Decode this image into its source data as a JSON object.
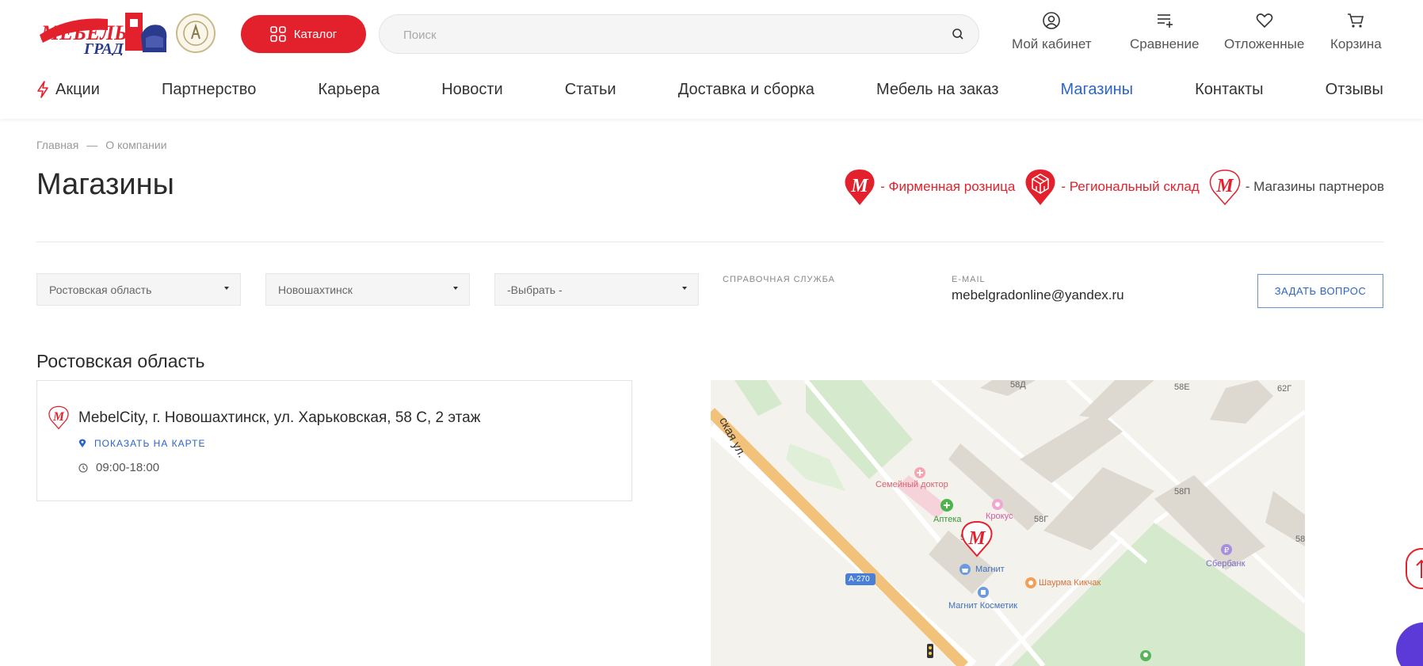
{
  "header": {
    "logo_text": "Мебель Град",
    "catalog_label": "Каталог",
    "search_placeholder": "Поиск",
    "actions": [
      {
        "label": "Мой кабинет",
        "icon": "user-icon"
      },
      {
        "label": "Сравнение",
        "icon": "compare-icon"
      },
      {
        "label": "Отложенные",
        "icon": "heart-icon"
      },
      {
        "label": "Корзина",
        "icon": "cart-icon"
      }
    ]
  },
  "nav": {
    "items": [
      "Акции",
      "Партнерство",
      "Карьера",
      "Новости",
      "Статьи",
      "Доставка и сборка",
      "Мебель на заказ",
      "Магазины",
      "Контакты",
      "Отзывы"
    ],
    "active": "Магазины"
  },
  "breadcrumb": {
    "home": "Главная",
    "separator": "—",
    "current": "О компании"
  },
  "page": {
    "title": "Магазины"
  },
  "legend": {
    "retail": "- Фирменная розница",
    "warehouse": "- Региональный склад",
    "partners": "- Магазины партнеров"
  },
  "filters": {
    "region": "Ростовская область",
    "city": "Новошахтинск",
    "store": "-Выбрать -"
  },
  "info": {
    "help_label": "СПРАВОЧНАЯ СЛУЖБА",
    "email_label": "E-MAIL",
    "email": "mebelgradonline@yandex.ru",
    "ask_button": "ЗАДАТЬ ВОПРОС"
  },
  "region": {
    "title": "Ростовская область",
    "store": {
      "name": "MebelCity, г. Новошахтинск, ул. Харьковская, 58 С, 2 этаж",
      "map_link": "ПОКАЗАТЬ НА КАРТЕ",
      "hours": "09:00-18:00"
    }
  },
  "map": {
    "street": "ская ул.",
    "road_badge": "А-270",
    "pois": {
      "doctor": "Семейный доктор",
      "pharmacy": "Аптека",
      "krokus": "Крокус",
      "magnit": "Магнит",
      "magnit_cosmetic": "Магнит Косметик",
      "shawarma": "Шаурма Кикчак",
      "sberbank": "Сбербанк"
    },
    "buildings": {
      "b58d": "58Д",
      "b58e": "58Е",
      "b62g": "62Г",
      "b58g": "58Г",
      "b58p": "58П",
      "b5": "5",
      "b58": "58"
    }
  },
  "colors": {
    "brand_red": "#e3212d",
    "link_blue": "#2d64c9"
  }
}
